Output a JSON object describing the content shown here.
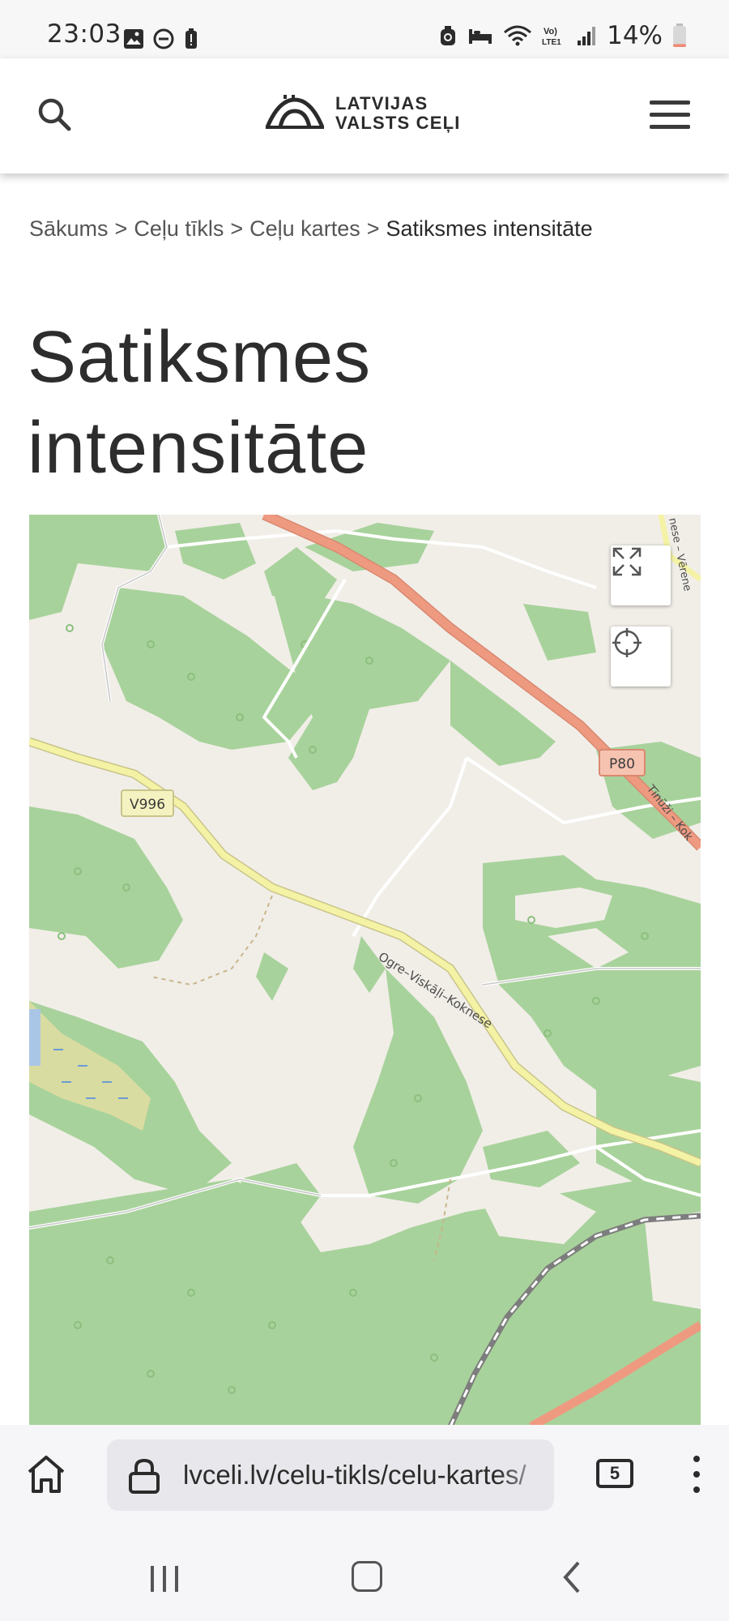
{
  "status_bar": {
    "time": "23:03",
    "battery_percent": "14%",
    "battery_level": 0.14,
    "icons": [
      "gallery-icon",
      "dnd-icon",
      "battery-saver-icon",
      "alarm-icon",
      "sleep-mode-icon",
      "wifi-icon",
      "volte-icon",
      "signal-icon",
      "battery-icon"
    ]
  },
  "header": {
    "logo_line1": "LATVIJAS",
    "logo_line2": "VALSTS CEĻI",
    "search_icon": "search-icon",
    "menu_icon": "hamburger-menu-icon"
  },
  "breadcrumb": {
    "items": [
      "Sākums",
      "Ceļu tīkls",
      "Ceļu kartes"
    ],
    "separator": ">",
    "current": "Satiksmes intensitāte"
  },
  "page": {
    "title_line1": "Satiksmes",
    "title_line2": "intensitāte"
  },
  "map": {
    "road_labels": [
      "V996",
      "P80"
    ],
    "road_name_1": "Ogre–Viskāļi–Koknese",
    "road_name_2": "Tīnūži – Kok",
    "road_name_3": "nese – Vērene",
    "fullscreen_icon": "fullscreen-icon",
    "locate_icon": "crosshair-icon",
    "colors": {
      "forest": "#a8d29b",
      "land": "#f1eee8",
      "main_road": "#ee9a81",
      "secondary_road": "#f4f2a4",
      "railway": "#7d7d7d"
    }
  },
  "browser": {
    "url": "lvceli.lv/celu-tikls/celu-kartes/",
    "tab_count": "5",
    "home_icon": "home-icon",
    "lock_icon": "lock-icon",
    "more_icon": "more-vertical-icon"
  },
  "nav": {
    "recent_icon": "recent-apps-icon",
    "home_icon": "home-button-icon",
    "back_icon": "back-icon"
  }
}
